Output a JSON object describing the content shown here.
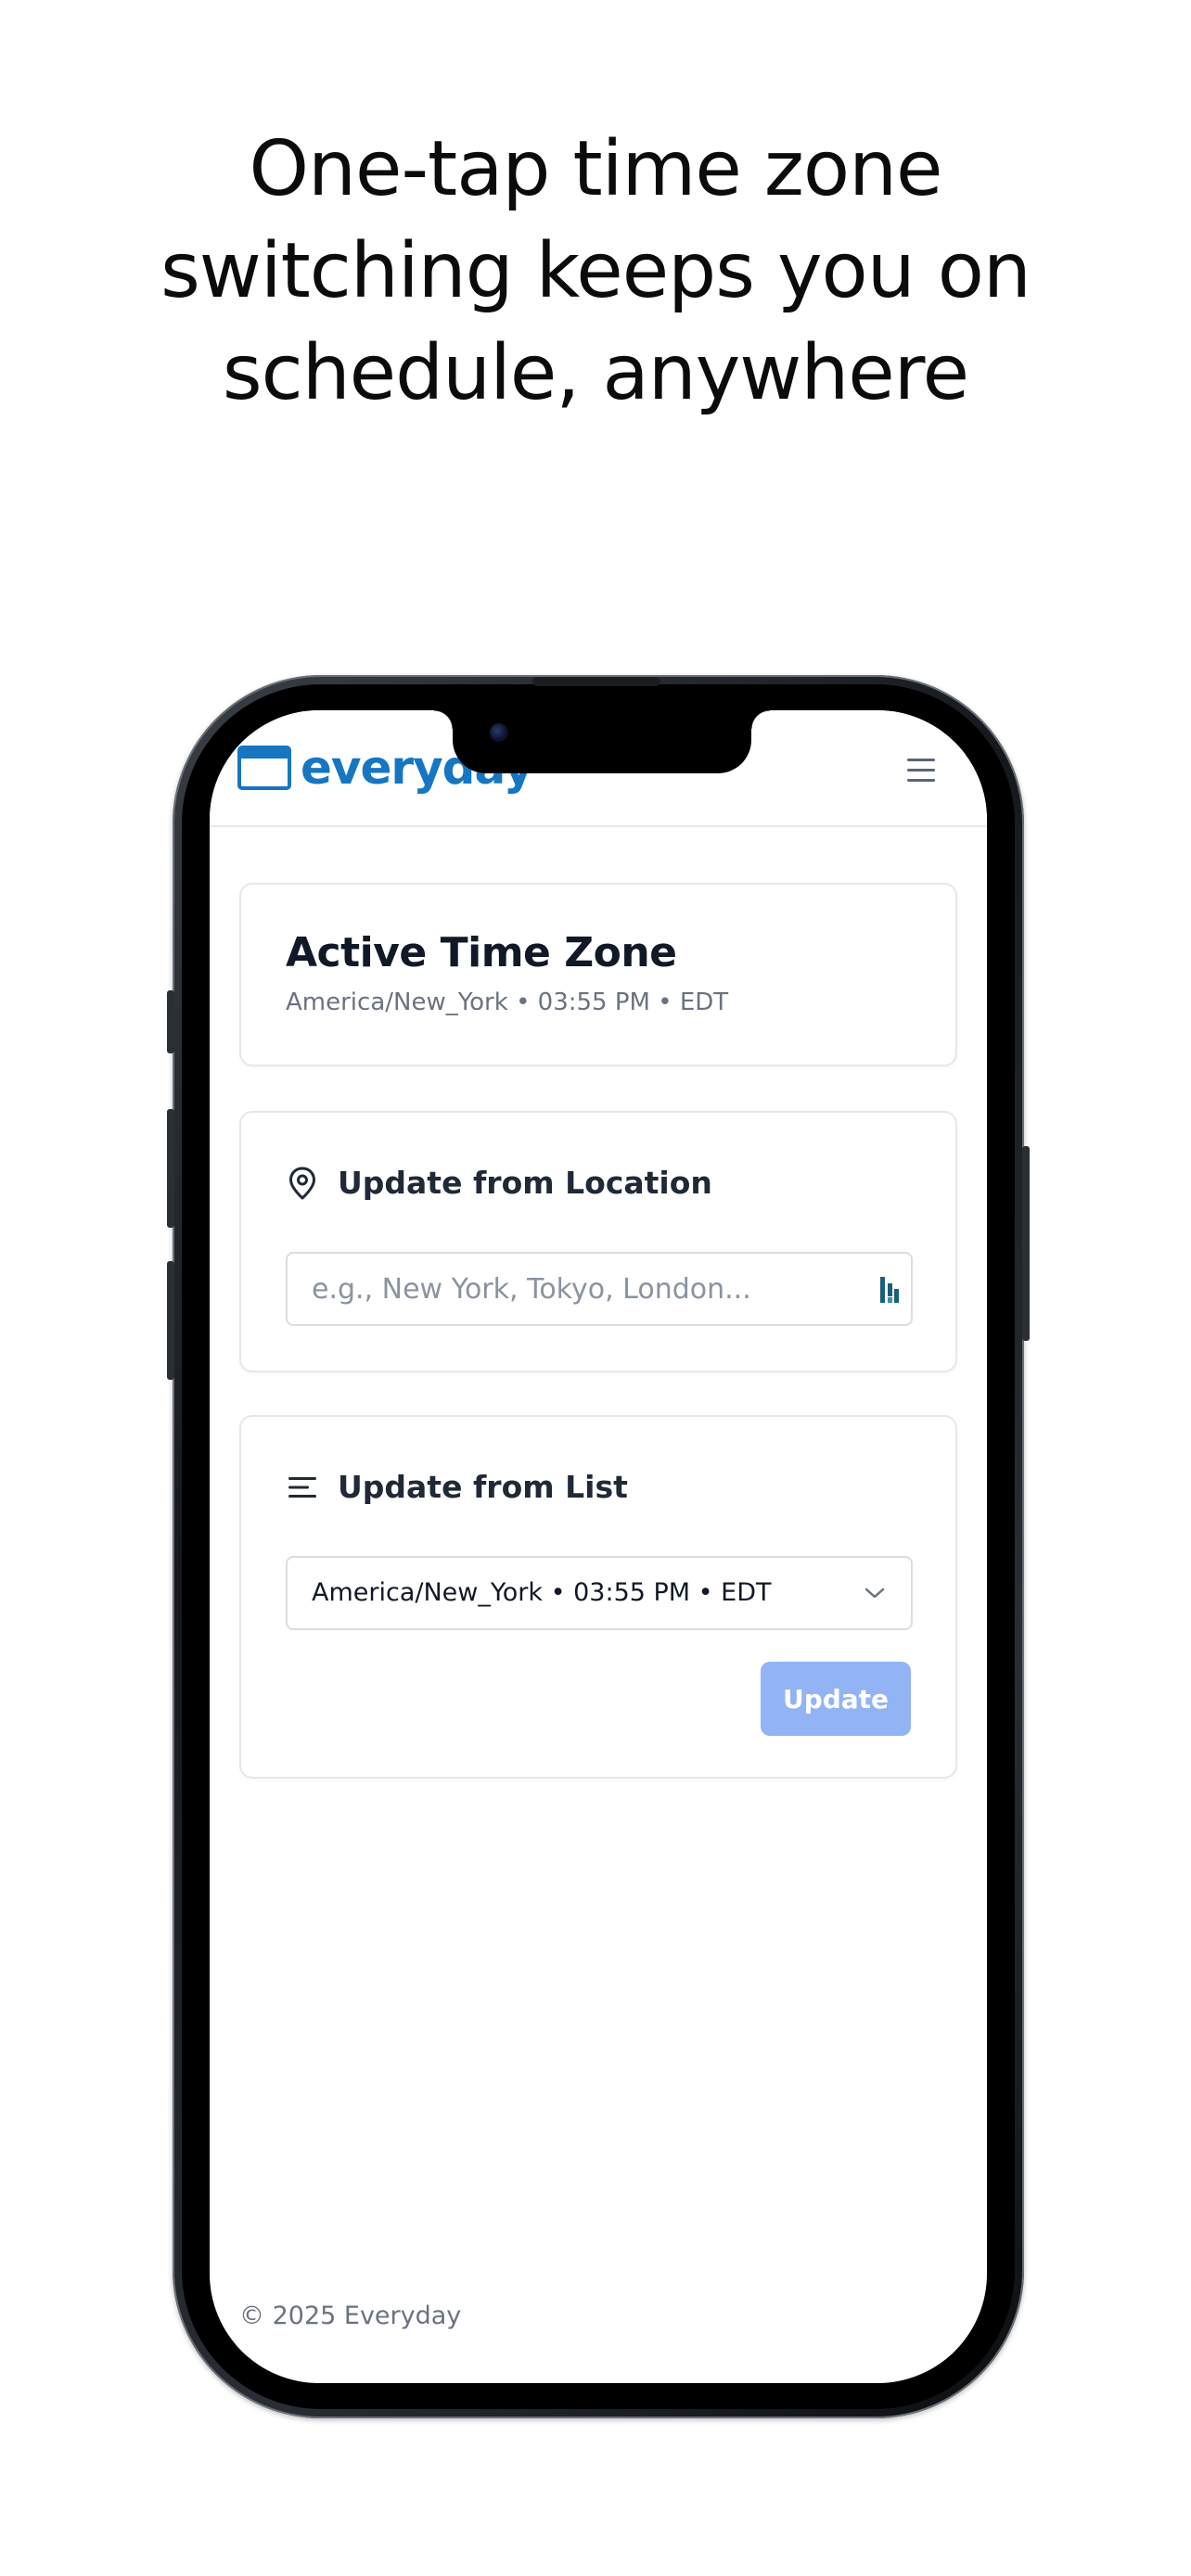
{
  "headline": {
    "line1": "One-tap time zone",
    "line2": "switching keeps you on",
    "line3": "schedule, anywhere"
  },
  "app": {
    "brand": "everyday",
    "brand_color": "#1676c1"
  },
  "active_zone": {
    "title": "Active Time Zone",
    "summary": "America/New_York • 03:55 PM • EDT"
  },
  "location_section": {
    "title": "Update from Location",
    "icon": "map-pin-icon",
    "input_value": "",
    "input_placeholder": "e.g., New York, Tokyo, London..."
  },
  "list_section": {
    "title": "Update from List",
    "icon": "list-icon",
    "selected_value": "America/New_York • 03:55 PM • EDT",
    "button_label": "Update",
    "button_color": "#93b4f4"
  },
  "footer": {
    "copyright": "© 2025 Everyday"
  }
}
